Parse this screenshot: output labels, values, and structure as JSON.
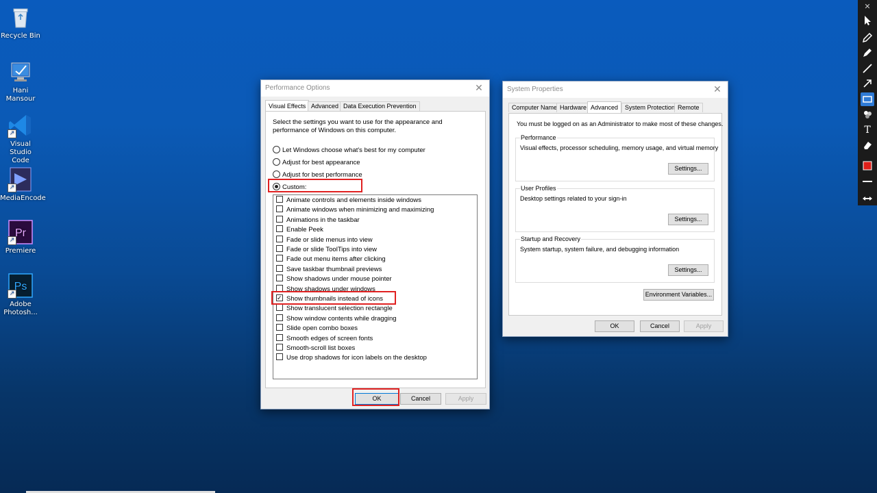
{
  "desktop": {
    "icons": [
      {
        "label": "Recycle Bin"
      },
      {
        "label": "Hani Mansour"
      },
      {
        "label": "Visual Studio Code"
      },
      {
        "label": "MediaEncode"
      },
      {
        "label": "Premiere"
      },
      {
        "label": "Adobe Photosh..."
      }
    ]
  },
  "performance_dialog": {
    "title": "Performance Options",
    "tabs": [
      "Visual Effects",
      "Advanced",
      "Data Execution Prevention"
    ],
    "active_tab": "Visual Effects",
    "intro": "Select the settings you want to use for the appearance and performance of Windows on this computer.",
    "intro_line1": "Select the settings you want to use for the appearance and",
    "intro_line2": "performance of Windows on this computer.",
    "radios": [
      {
        "label": "Let Windows choose what's best for my computer",
        "selected": false
      },
      {
        "label": "Adjust for best appearance",
        "selected": false
      },
      {
        "label": "Adjust for best performance",
        "selected": false
      },
      {
        "label": "Custom:",
        "selected": true
      }
    ],
    "checkboxes": [
      {
        "label": "Animate controls and elements inside windows",
        "checked": false
      },
      {
        "label": "Animate windows when minimizing and maximizing",
        "checked": false
      },
      {
        "label": "Animations in the taskbar",
        "checked": false
      },
      {
        "label": "Enable Peek",
        "checked": false
      },
      {
        "label": "Fade or slide menus into view",
        "checked": false
      },
      {
        "label": "Fade or slide ToolTips into view",
        "checked": false
      },
      {
        "label": "Fade out menu items after clicking",
        "checked": false
      },
      {
        "label": "Save taskbar thumbnail previews",
        "checked": false
      },
      {
        "label": "Show shadows under mouse pointer",
        "checked": false
      },
      {
        "label": "Show shadows under windows",
        "checked": false
      },
      {
        "label": "Show thumbnails instead of icons",
        "checked": true
      },
      {
        "label": "Show translucent selection rectangle",
        "checked": false
      },
      {
        "label": "Show window contents while dragging",
        "checked": false
      },
      {
        "label": "Slide open combo boxes",
        "checked": false
      },
      {
        "label": "Smooth edges of screen fonts",
        "checked": false
      },
      {
        "label": "Smooth-scroll list boxes",
        "checked": false
      },
      {
        "label": "Use drop shadows for icon labels on the desktop",
        "checked": false
      }
    ],
    "buttons": {
      "ok": "OK",
      "cancel": "Cancel",
      "apply": "Apply"
    }
  },
  "system_dialog": {
    "title": "System Properties",
    "tabs": [
      "Computer Name",
      "Hardware",
      "Advanced",
      "System Protection",
      "Remote"
    ],
    "active_tab": "Advanced",
    "admin_note": "You must be logged on as an Administrator to make most of these changes.",
    "groups": [
      {
        "title": "Performance",
        "desc": "Visual effects, processor scheduling, memory usage, and virtual memory",
        "button": "Settings..."
      },
      {
        "title": "User Profiles",
        "desc": "Desktop settings related to your sign-in",
        "button": "Settings..."
      },
      {
        "title": "Startup and Recovery",
        "desc": "System startup, system failure, and debugging information",
        "button": "Settings..."
      }
    ],
    "env_button": "Environment Variables...",
    "buttons": {
      "ok": "OK",
      "cancel": "Cancel",
      "apply": "Apply"
    }
  },
  "toolbar": {
    "close_symbol": "✕",
    "tools": [
      "cursor-icon",
      "pen-icon",
      "highlighter-icon",
      "line-icon",
      "arrow-icon",
      "rectangle-icon",
      "palette-icon",
      "text-icon",
      "eraser-icon",
      "color-swatch",
      "stroke-width-icon",
      "move-icon"
    ],
    "active_tool": "rectangle-icon",
    "accent_color": "#e0201a"
  }
}
